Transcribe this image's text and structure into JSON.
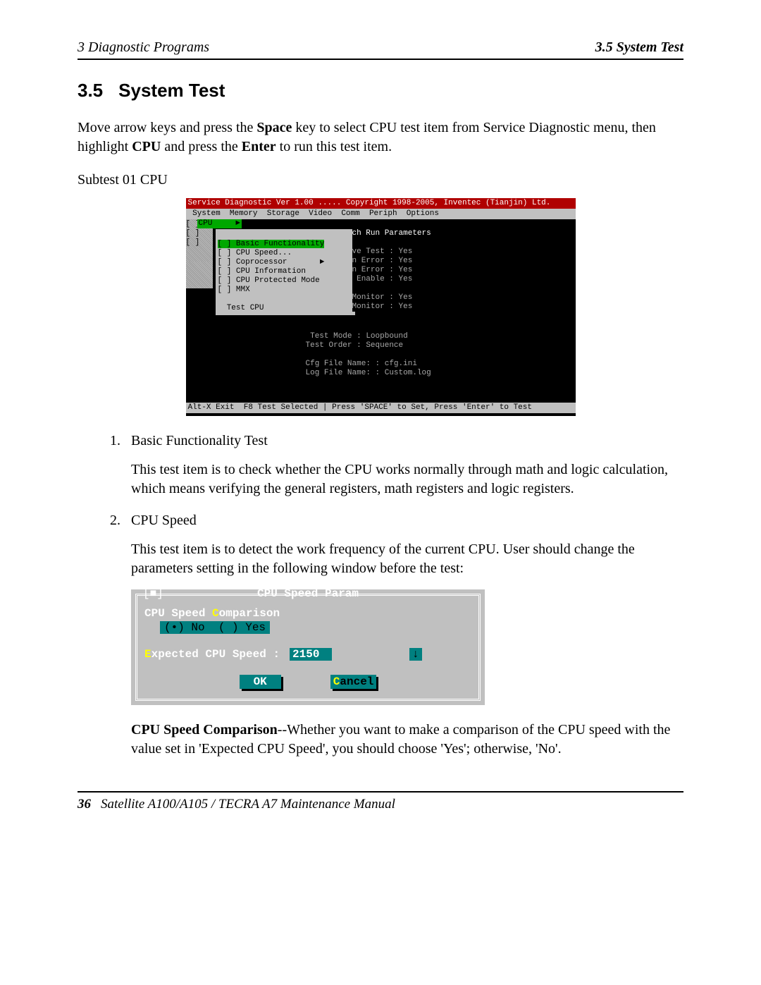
{
  "header": {
    "left": "3  Diagnostic Programs",
    "right": "3.5 System Test"
  },
  "heading": {
    "num": "3.5",
    "title": "System Test"
  },
  "intro": {
    "p1a": "Move arrow keys and press the ",
    "space": "Space",
    "p1b": " key to select CPU test item from Service Diagnostic menu, then highlight ",
    "cpu": "CPU",
    "p1c": " and press the ",
    "enter": "Enter",
    "p1d": " to run this test item."
  },
  "subtest_label": "Subtest 01 CPU",
  "dos1": {
    "top": "Service Diagnostic Ver 1.00 ..... Copyright 1998-2005, Inventec (Tianjin) Ltd.",
    "menubar": " System  Memory  Storage  Video  Comm  Periph  Options",
    "left_stub": "[ ]\n[ ]\n[ ]",
    "cpu_sel": "CPU     ►",
    "submenu": {
      "i0": "[ ] Basic Functionality",
      "i1": "[ ] CPU Speed...",
      "i2": "[ ] Coprocessor       ►",
      "i3": "[ ] CPU Information",
      "i4": "[ ] CPU Protected Mode",
      "i5": "[ ] MMX",
      "test": "  Test CPU"
    },
    "panel": {
      "hdr": "ch Run Parameters",
      "l1": "ve Test : Yes",
      "l2": "n Error : Yes",
      "l3": "n Error : Yes",
      "l4": " Enable : Yes",
      "l5": "Monitor : Yes",
      "l6": "Monitor : Yes"
    },
    "below": {
      "b1": " Test Mode : Loopbound",
      "b2": "Test Order : Sequence",
      "b3": "Cfg File Name: : cfg.ini",
      "b4": "Log File Name: : Custom.log"
    },
    "bottom": "Alt-X Exit  F8 Test Selected | Press 'SPACE' to Set, Press 'Enter' to Test"
  },
  "list": {
    "item1": {
      "title": "Basic Functionality Test",
      "body": "This test item is to check whether the CPU works normally through math and logic calculation, which means verifying the general registers, math registers and logic registers."
    },
    "item2": {
      "title": "CPU Speed",
      "body": "This test item is to detect the work frequency of the current CPU. User should change the parameters setting in the following window before the test:"
    }
  },
  "dos2": {
    "close": "[■]",
    "title": "CPU Speed Param",
    "label1_pre": "CPU Speed ",
    "label1_hot": "C",
    "label1_post": "omparison",
    "radio_no": "(•) No",
    "radio_yes": "( ) Yes",
    "label2_hot": "E",
    "label2_rest": "xpected CPU Speed :",
    "value": "2150",
    "spin": "↓",
    "ok": "OK",
    "cancel_hot": "C",
    "cancel_rest": "ancel"
  },
  "para3": {
    "bold": "CPU Speed Comparison",
    "rest": "--Whether you want to make a comparison of the CPU speed with the value set in 'Expected CPU Speed', you should choose 'Yes'; otherwise, 'No'."
  },
  "footer": {
    "page": "36",
    "text": "Satellite A100/A105 / TECRA A7 Maintenance Manual"
  }
}
